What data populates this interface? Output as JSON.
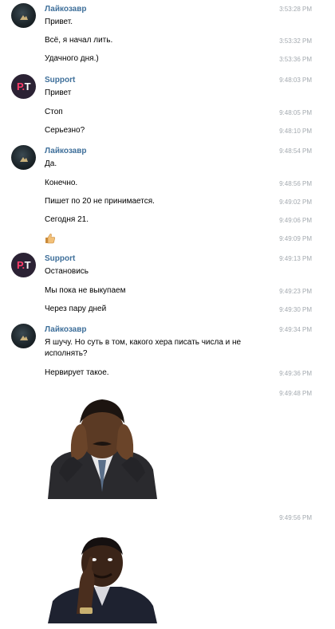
{
  "users": {
    "laikozavr": "Лайкозавр",
    "support": "Support"
  },
  "avatar_support_text": {
    "p": "P",
    "dot": ".",
    "t": "T"
  },
  "messages": [
    {
      "text": "Привет.",
      "time": "3:53:28 PM"
    },
    {
      "text": "Всё, я начал лить.",
      "time": "3:53:32 PM"
    },
    {
      "text": "Удачного дня.)",
      "time": "3:53:36 PM"
    },
    {
      "text": "Привет",
      "time": "9:48:03 PM"
    },
    {
      "text": "Стоп",
      "time": "9:48:05 PM"
    },
    {
      "text": "Серьезно?",
      "time": "9:48:10 PM"
    },
    {
      "text": "Да.",
      "time": "9:48:54 PM"
    },
    {
      "text": "Конечно.",
      "time": "9:48:56 PM"
    },
    {
      "text": "Пишет по 20 не принимается.",
      "time": "9:49:02 PM"
    },
    {
      "text": "Сегодня 21.",
      "time": "9:49:06 PM"
    },
    {
      "text": "",
      "time": "9:49:09 PM"
    },
    {
      "text": "Остановись",
      "time": "9:49:13 PM"
    },
    {
      "text": "Мы пока не выкупаем",
      "time": "9:49:23 PM"
    },
    {
      "text": "Через пару дней",
      "time": "9:49:30 PM"
    },
    {
      "text": "Я шучу. Но суть в том, какого хера писать числа и не исполнять?",
      "time": "9:49:34 PM"
    },
    {
      "text": "Нервирует такое.",
      "time": "9:49:36 PM"
    },
    {
      "text": "",
      "time": "9:49:48 PM"
    },
    {
      "text": "",
      "time": "9:49:56 PM"
    }
  ],
  "icons": {
    "thumb": "thumbs-up-emoji",
    "sticker1": "facepalm-man-sticker",
    "sticker2": "thinking-man-sticker"
  }
}
